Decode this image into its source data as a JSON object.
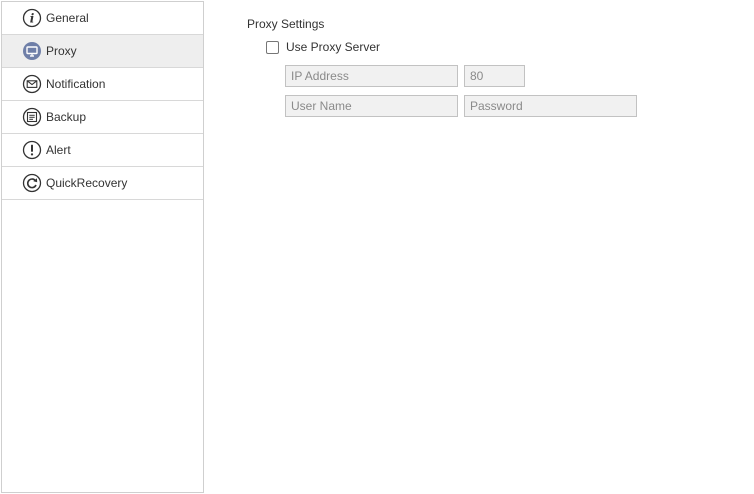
{
  "sidebar": {
    "items": [
      {
        "label": "General",
        "icon": "info-icon",
        "active": false
      },
      {
        "label": "Proxy",
        "icon": "monitor-icon",
        "active": true
      },
      {
        "label": "Notification",
        "icon": "mail-icon",
        "active": false
      },
      {
        "label": "Backup",
        "icon": "backup-icon",
        "active": false
      },
      {
        "label": "Alert",
        "icon": "alert-icon",
        "active": false
      },
      {
        "label": "QuickRecovery",
        "icon": "recovery-icon",
        "active": false
      }
    ]
  },
  "proxy": {
    "section_title": "Proxy Settings",
    "use_proxy_label": "Use Proxy Server",
    "use_proxy_checked": false,
    "ip_placeholder": "IP Address",
    "port_placeholder": "80",
    "username_placeholder": "User Name",
    "password_placeholder": "Password"
  },
  "colors": {
    "active_item_bg": "#eeeeee",
    "active_icon_bg": "#6f7fa8",
    "input_bg": "#f1f1f1",
    "border": "#cfcfcf"
  }
}
